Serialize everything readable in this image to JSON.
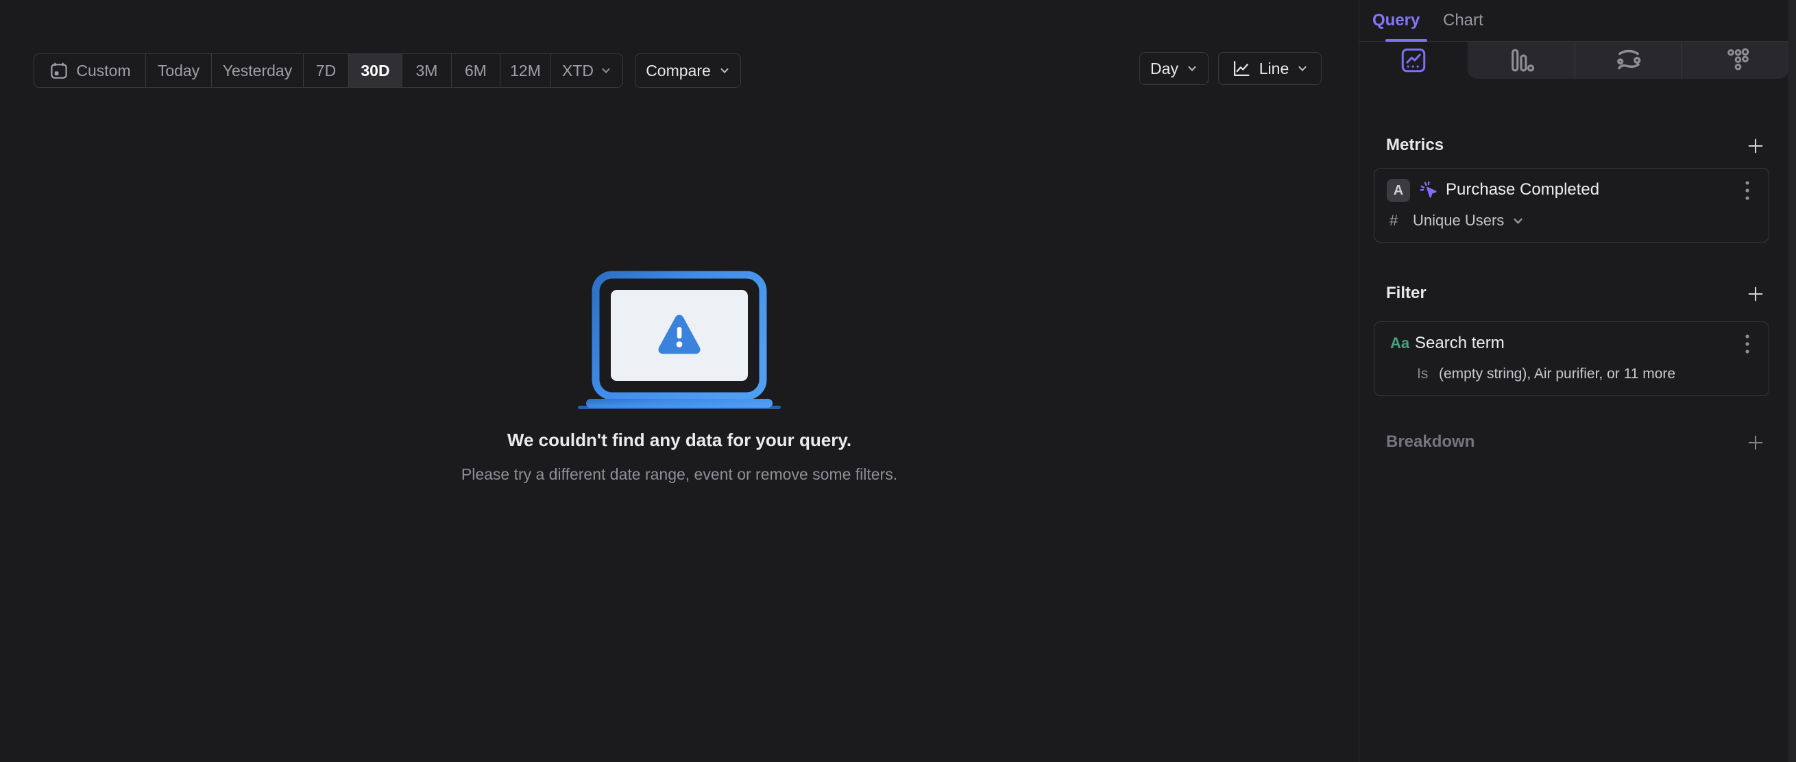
{
  "colors": {
    "accent_purple": "#7d71f3",
    "illustration_blue": "#3f8de9",
    "illustration_blue_dark": "#2d6fc4",
    "illustration_blue_light": "#4f9ef2",
    "filter_green": "#48a27d",
    "active_segment_bg": "#2f2f34"
  },
  "toolbar": {
    "segments": [
      {
        "label": "Custom"
      },
      {
        "label": "Today"
      },
      {
        "label": "Yesterday"
      },
      {
        "label": "7D"
      },
      {
        "label": "30D"
      },
      {
        "label": "3M"
      },
      {
        "label": "6M"
      },
      {
        "label": "12M"
      },
      {
        "label": "XTD"
      }
    ],
    "active_segment": "30D",
    "compare_label": "Compare",
    "granularity_label": "Day",
    "chart_type_label": "Line"
  },
  "empty_state": {
    "title": "We couldn't find any data for your query.",
    "subtitle": "Please try a different date range, event or remove some filters."
  },
  "sidebar": {
    "tabs": [
      {
        "label": "Query",
        "active": true
      },
      {
        "label": "Chart",
        "active": false
      }
    ],
    "report_tabs": [
      {
        "icon": "insights-icon",
        "active": true
      },
      {
        "icon": "funnels-icon",
        "active": false
      },
      {
        "icon": "flows-icon",
        "active": false
      },
      {
        "icon": "retention-icon",
        "active": false
      }
    ],
    "metrics": {
      "heading": "Metrics",
      "items": [
        {
          "letter": "A",
          "icon": "event-cursor-icon",
          "name": "Purchase Completed",
          "aggregation_symbol": "#",
          "aggregation": "Unique Users"
        }
      ]
    },
    "filter": {
      "heading": "Filter",
      "items": [
        {
          "type_badge": "Aa",
          "name": "Search term",
          "operator": "Is",
          "value": "(empty string), Air purifier, or 11 more"
        }
      ]
    },
    "breakdown": {
      "heading": "Breakdown"
    }
  }
}
